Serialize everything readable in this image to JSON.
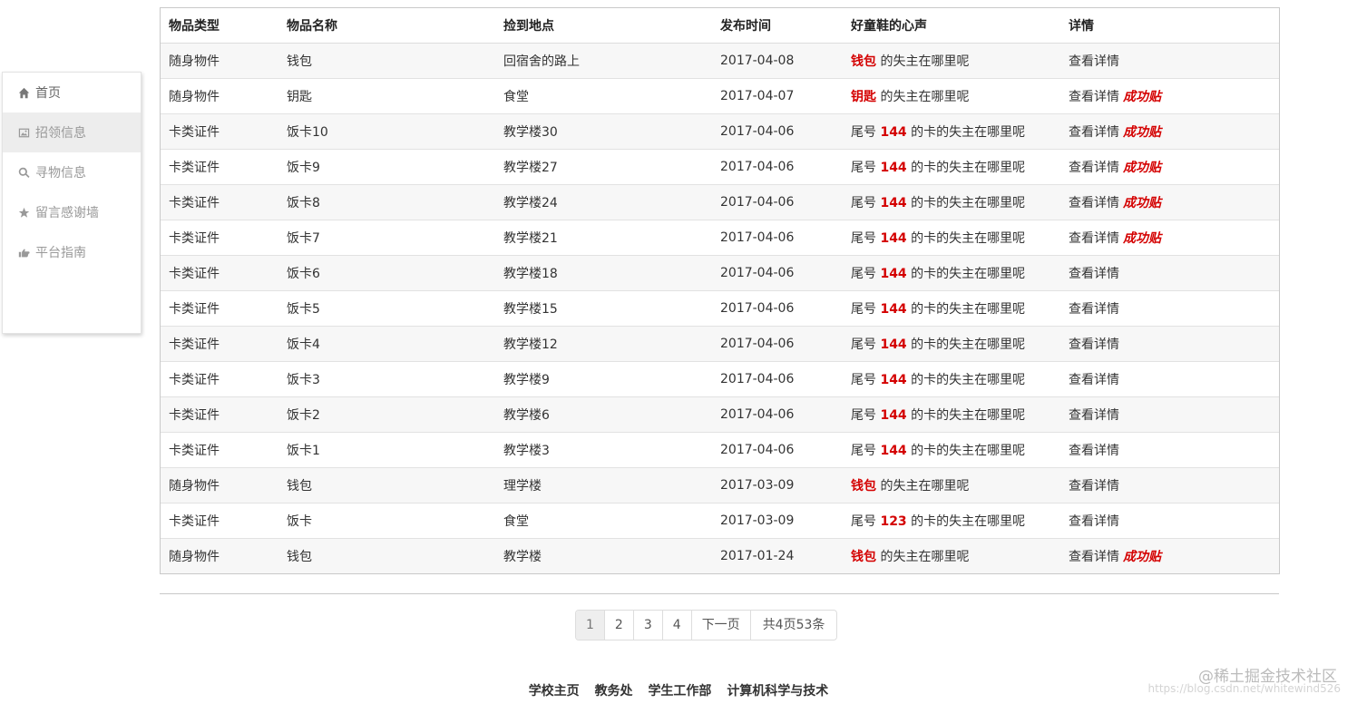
{
  "sidebar": {
    "items": [
      {
        "label": "首页",
        "icon": "home-icon"
      },
      {
        "label": "招领信息",
        "icon": "image-icon"
      },
      {
        "label": "寻物信息",
        "icon": "search-icon"
      },
      {
        "label": "留言感谢墙",
        "icon": "star-icon"
      },
      {
        "label": "平台指南",
        "icon": "hand-pointer-icon"
      }
    ]
  },
  "table": {
    "headers": [
      "物品类型",
      "物品名称",
      "捡到地点",
      "发布时间",
      "好童鞋的心声",
      "详情"
    ],
    "detail_label": "查看详情",
    "success_label": "成功贴",
    "voice": {
      "card_prefix": "尾号",
      "card_suffix": "的卡的失主在哪里呢",
      "item_suffix": "的失主在哪里呢"
    },
    "rows": [
      {
        "type": "随身物件",
        "name": "钱包",
        "place": "回宿舍的路上",
        "date": "2017-04-08",
        "key": "钱包",
        "success": false
      },
      {
        "type": "随身物件",
        "name": "钥匙",
        "place": "食堂",
        "date": "2017-04-07",
        "key": "钥匙",
        "success": true
      },
      {
        "type": "卡类证件",
        "name": "饭卡10",
        "place": "教学楼30",
        "date": "2017-04-06",
        "key": "144",
        "success": true
      },
      {
        "type": "卡类证件",
        "name": "饭卡9",
        "place": "教学楼27",
        "date": "2017-04-06",
        "key": "144",
        "success": true
      },
      {
        "type": "卡类证件",
        "name": "饭卡8",
        "place": "教学楼24",
        "date": "2017-04-06",
        "key": "144",
        "success": true
      },
      {
        "type": "卡类证件",
        "name": "饭卡7",
        "place": "教学楼21",
        "date": "2017-04-06",
        "key": "144",
        "success": true
      },
      {
        "type": "卡类证件",
        "name": "饭卡6",
        "place": "教学楼18",
        "date": "2017-04-06",
        "key": "144",
        "success": false
      },
      {
        "type": "卡类证件",
        "name": "饭卡5",
        "place": "教学楼15",
        "date": "2017-04-06",
        "key": "144",
        "success": false
      },
      {
        "type": "卡类证件",
        "name": "饭卡4",
        "place": "教学楼12",
        "date": "2017-04-06",
        "key": "144",
        "success": false
      },
      {
        "type": "卡类证件",
        "name": "饭卡3",
        "place": "教学楼9",
        "date": "2017-04-06",
        "key": "144",
        "success": false
      },
      {
        "type": "卡类证件",
        "name": "饭卡2",
        "place": "教学楼6",
        "date": "2017-04-06",
        "key": "144",
        "success": false
      },
      {
        "type": "卡类证件",
        "name": "饭卡1",
        "place": "教学楼3",
        "date": "2017-04-06",
        "key": "144",
        "success": false
      },
      {
        "type": "随身物件",
        "name": "钱包",
        "place": "理学楼",
        "date": "2017-03-09",
        "key": "钱包",
        "success": false
      },
      {
        "type": "卡类证件",
        "name": "饭卡",
        "place": "食堂",
        "date": "2017-03-09",
        "key": "123",
        "success": false
      },
      {
        "type": "随身物件",
        "name": "钱包",
        "place": "教学楼",
        "date": "2017-01-24",
        "key": "钱包",
        "success": true
      }
    ]
  },
  "pagination": {
    "pages": [
      "1",
      "2",
      "3",
      "4"
    ],
    "current": "1",
    "next_label": "下一页",
    "info": "共4页53条"
  },
  "footer": {
    "links": [
      "学校主页",
      "教务处",
      "学生工作部",
      "计算机科学与技术"
    ]
  },
  "watermark": {
    "brand": "@稀土掘金技术社区",
    "url": "https://blog.csdn.net/whitewind526"
  },
  "colors": {
    "highlight": "#d40000",
    "stripe": "#f7f7f7",
    "sidebar_active": "#ededed"
  }
}
